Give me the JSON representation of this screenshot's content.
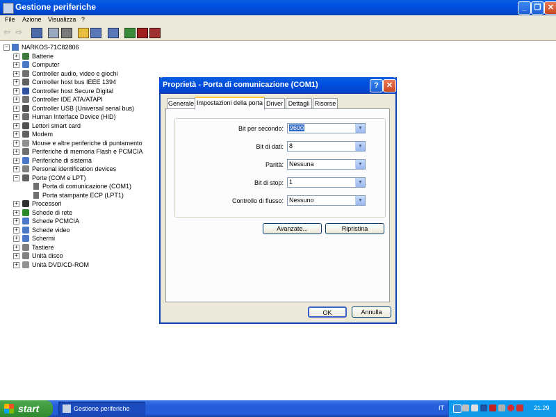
{
  "window": {
    "title": "Gestione periferiche"
  },
  "menu": [
    "File",
    "Azione",
    "Visualizza",
    "?"
  ],
  "tree": {
    "root": "NARKOS-71C82806",
    "items": [
      {
        "label": "Batterie",
        "icon": "battery-icon",
        "color": "#3a7a3a"
      },
      {
        "label": "Computer",
        "icon": "computer-icon",
        "color": "#4a78c8"
      },
      {
        "label": "Controller audio, video e giochi",
        "icon": "audio-icon",
        "color": "#707070"
      },
      {
        "label": "Controller host bus IEEE 1394",
        "icon": "ieee1394-icon",
        "color": "#606060"
      },
      {
        "label": "Controller host Secure Digital",
        "icon": "sd-icon",
        "color": "#3050a0"
      },
      {
        "label": "Controller IDE ATA/ATAPI",
        "icon": "ide-icon",
        "color": "#707070"
      },
      {
        "label": "Controller USB (Universal serial bus)",
        "icon": "usb-icon",
        "color": "#505050"
      },
      {
        "label": "Human Interface Device (HID)",
        "icon": "hid-icon",
        "color": "#6a6a6a"
      },
      {
        "label": "Lettori smart card",
        "icon": "smartcard-icon",
        "color": "#505050"
      },
      {
        "label": "Modem",
        "icon": "modem-icon",
        "color": "#606060"
      },
      {
        "label": "Mouse e altre periferiche di puntamento",
        "icon": "mouse-icon",
        "color": "#909090"
      },
      {
        "label": "Periferiche di memoria Flash e PCMCIA",
        "icon": "flash-memory-icon",
        "color": "#707070"
      },
      {
        "label": "Periferiche di sistema",
        "icon": "system-device-icon",
        "color": "#4a78c8"
      },
      {
        "label": "Personal identification devices",
        "icon": "id-device-icon",
        "color": "#808080"
      },
      {
        "label": "Porte (COM e LPT)",
        "icon": "port-icon",
        "color": "#606060",
        "expanded": true,
        "children": [
          "Porta di comunicazione (COM1)",
          "Porta stampante ECP (LPT1)"
        ]
      },
      {
        "label": "Processori",
        "icon": "processor-icon",
        "color": "#303030"
      },
      {
        "label": "Schede di rete",
        "icon": "network-card-icon",
        "color": "#2a8a2a"
      },
      {
        "label": "Schede PCMCIA",
        "icon": "pcmcia-icon",
        "color": "#4a78c8"
      },
      {
        "label": "Schede video",
        "icon": "video-card-icon",
        "color": "#4a78c8"
      },
      {
        "label": "Schermi",
        "icon": "monitor-icon",
        "color": "#4a78c8"
      },
      {
        "label": "Tastiere",
        "icon": "keyboard-icon",
        "color": "#808080"
      },
      {
        "label": "Unità disco",
        "icon": "disk-drive-icon",
        "color": "#808080"
      },
      {
        "label": "Unità DVD/CD-ROM",
        "icon": "dvd-icon",
        "color": "#909090"
      }
    ]
  },
  "dialog": {
    "title": "Proprietà - Porta di comunicazione (COM1)",
    "tabs": [
      "Generale",
      "Impostazioni della porta",
      "Driver",
      "Dettagli",
      "Risorse"
    ],
    "active_tab": "Impostazioni della porta",
    "fields": [
      {
        "label": "Bit per secondo:",
        "value": "9600",
        "selected": true
      },
      {
        "label": "Bit di dati:",
        "value": "8"
      },
      {
        "label": "Parità:",
        "value": "Nessuna"
      },
      {
        "label": "Bit di stop:",
        "value": "1"
      },
      {
        "label": "Controllo di flusso:",
        "value": "Nessuno"
      }
    ],
    "advanced_button": "Avanzate...",
    "restore_button": "Ripristina",
    "ok_button": "OK",
    "cancel_button": "Annulla"
  },
  "taskbar": {
    "start_label": "start",
    "task_label": "Gestione periferiche",
    "language": "IT",
    "clock": "21.29"
  },
  "colors": {
    "title_blue": "#0054e3",
    "taskbar_blue": "#245edb",
    "start_green": "#3c9a3c",
    "dialog_bg": "#ece9d8"
  }
}
